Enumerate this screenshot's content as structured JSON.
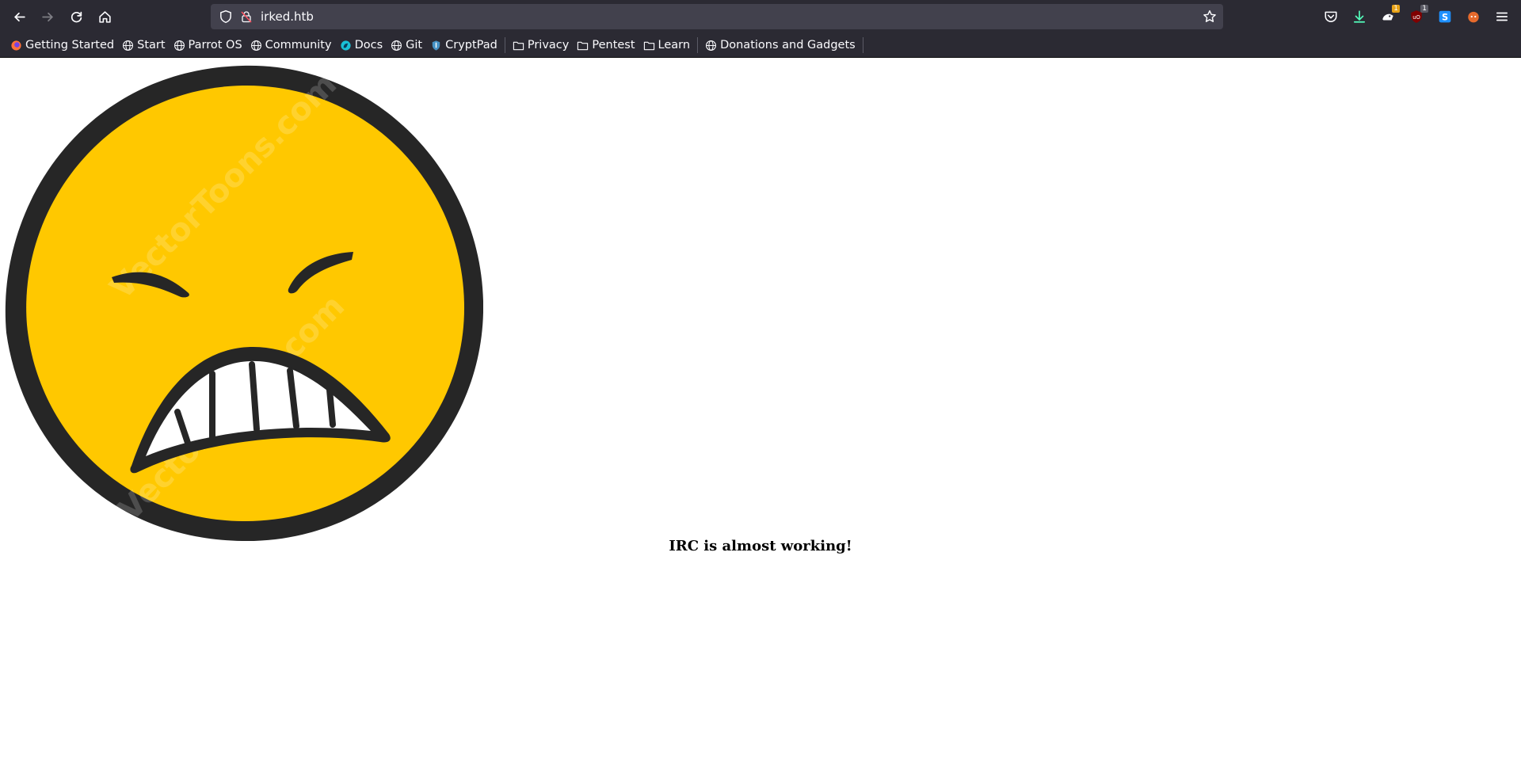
{
  "browser": {
    "url": "irked.htb",
    "colors": {
      "chrome": "#2b2a33",
      "urlbar": "#42414d",
      "text": "#fbfbfe"
    }
  },
  "bookmarks": [
    {
      "label": "Getting Started",
      "icon": "firefox-icon"
    },
    {
      "label": "Start",
      "icon": "globe-icon"
    },
    {
      "label": "Parrot OS",
      "icon": "globe-icon"
    },
    {
      "label": "Community",
      "icon": "globe-icon"
    },
    {
      "label": "Docs",
      "icon": "parrot-icon"
    },
    {
      "label": "Git",
      "icon": "globe-icon"
    },
    {
      "label": "CryptPad",
      "icon": "shield-icon"
    },
    {
      "label": "Privacy",
      "icon": "folder-icon"
    },
    {
      "label": "Pentest",
      "icon": "folder-icon"
    },
    {
      "label": "Learn",
      "icon": "folder-icon"
    },
    {
      "label": "Donations and Gadgets",
      "icon": "globe-icon"
    }
  ],
  "toolbar_badges": {
    "extension_one": "1",
    "ublock": "1"
  },
  "page": {
    "message": "IRC is almost working!",
    "image_watermark": "VectorToons.com",
    "image_colors": {
      "face": "#ffc800",
      "outline": "#262626"
    }
  }
}
